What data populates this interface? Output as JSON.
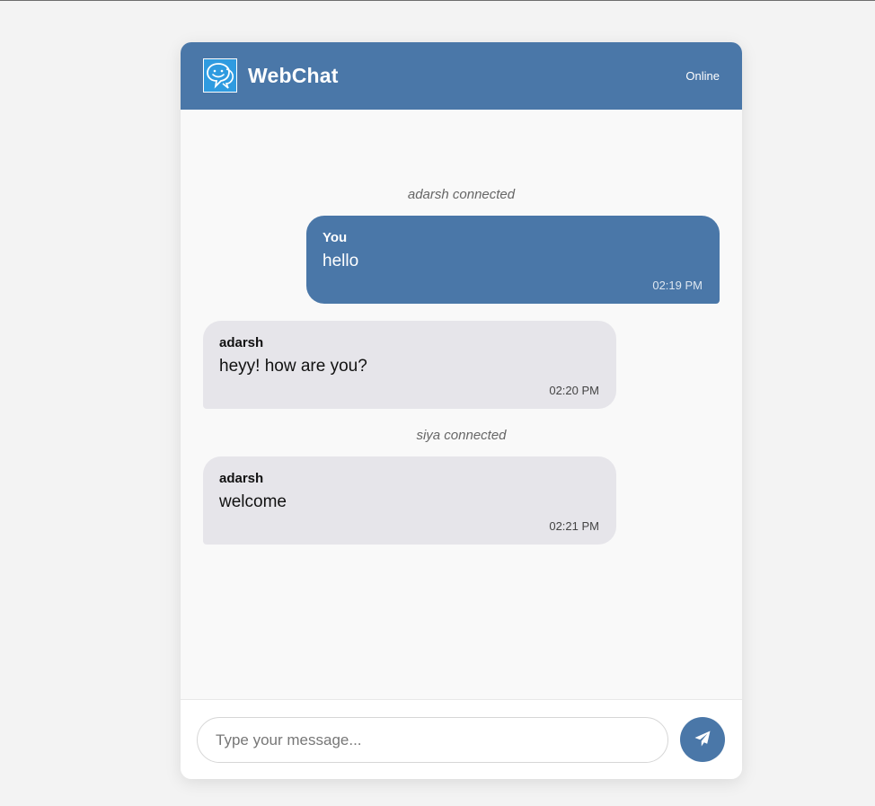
{
  "header": {
    "app_title": "WebChat",
    "status": "Online"
  },
  "messages": [
    {
      "type": "system",
      "text": "adarsh connected"
    },
    {
      "type": "message",
      "direction": "outgoing",
      "sender": "You",
      "text": "hello",
      "time": "02:19 PM"
    },
    {
      "type": "message",
      "direction": "incoming",
      "sender": "adarsh",
      "text": "heyy! how are you?",
      "time": "02:20 PM"
    },
    {
      "type": "system",
      "text": "siya connected"
    },
    {
      "type": "message",
      "direction": "incoming",
      "sender": "adarsh",
      "text": "welcome",
      "time": "02:21 PM"
    }
  ],
  "composer": {
    "placeholder": "Type your message...",
    "value": ""
  },
  "colors": {
    "accent": "#4a77a8",
    "incoming_bubble": "#e6e5ea",
    "logo": "#2f9be0"
  },
  "icons": {
    "logo": "smiley-chat-bubble-icon",
    "send": "paper-plane-icon"
  }
}
